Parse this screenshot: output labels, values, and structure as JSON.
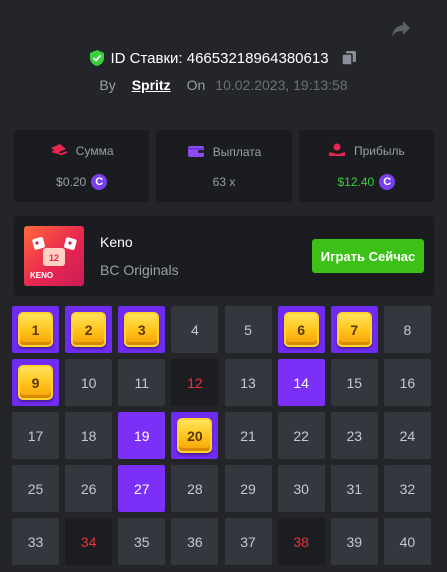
{
  "header": {
    "bet_id": "ID Ставки: 46653218964380613",
    "by_label": "By",
    "username": "Spritz",
    "on_label": "On",
    "datetime": "10.02.2023, 19:13:58"
  },
  "stats": [
    {
      "label": "Сумма",
      "value": "$0.20",
      "icon": "money-icon",
      "coin": true
    },
    {
      "label": "Выплата",
      "value": "63 x",
      "icon": "wallet-icon",
      "coin": false
    },
    {
      "label": "Прибыль",
      "value": "$12.40",
      "icon": "profit-icon",
      "coin": true
    }
  ],
  "coin_symbol": "C",
  "game": {
    "name": "Keno",
    "provider": "BC Originals",
    "play_label": "Играть Сейчас",
    "thumb_label": "KENO",
    "thumb_ball": "12"
  },
  "grid": [
    {
      "n": "1",
      "state": "gem"
    },
    {
      "n": "2",
      "state": "gem"
    },
    {
      "n": "3",
      "state": "gem"
    },
    {
      "n": "4",
      "state": "normal"
    },
    {
      "n": "5",
      "state": "normal"
    },
    {
      "n": "6",
      "state": "gem"
    },
    {
      "n": "7",
      "state": "gem"
    },
    {
      "n": "8",
      "state": "normal"
    },
    {
      "n": "9",
      "state": "gem"
    },
    {
      "n": "10",
      "state": "normal"
    },
    {
      "n": "11",
      "state": "normal"
    },
    {
      "n": "12",
      "state": "miss"
    },
    {
      "n": "13",
      "state": "normal"
    },
    {
      "n": "14",
      "state": "hit"
    },
    {
      "n": "15",
      "state": "normal"
    },
    {
      "n": "16",
      "state": "normal"
    },
    {
      "n": "17",
      "state": "normal"
    },
    {
      "n": "18",
      "state": "normal"
    },
    {
      "n": "19",
      "state": "hit"
    },
    {
      "n": "20",
      "state": "gem-dark"
    },
    {
      "n": "21",
      "state": "normal"
    },
    {
      "n": "22",
      "state": "normal"
    },
    {
      "n": "23",
      "state": "normal"
    },
    {
      "n": "24",
      "state": "normal"
    },
    {
      "n": "25",
      "state": "normal"
    },
    {
      "n": "26",
      "state": "normal"
    },
    {
      "n": "27",
      "state": "hit"
    },
    {
      "n": "28",
      "state": "normal"
    },
    {
      "n": "29",
      "state": "normal"
    },
    {
      "n": "30",
      "state": "normal"
    },
    {
      "n": "31",
      "state": "normal"
    },
    {
      "n": "32",
      "state": "normal"
    },
    {
      "n": "33",
      "state": "normal"
    },
    {
      "n": "34",
      "state": "miss"
    },
    {
      "n": "35",
      "state": "normal"
    },
    {
      "n": "36",
      "state": "normal"
    },
    {
      "n": "37",
      "state": "normal"
    },
    {
      "n": "38",
      "state": "miss"
    },
    {
      "n": "39",
      "state": "normal"
    },
    {
      "n": "40",
      "state": "normal"
    }
  ],
  "colors": {
    "background": "#232529",
    "panel": "#1a1c1f",
    "accent_purple": "#7b2ff7",
    "play_green": "#3bc117",
    "profit_green": "#38d13b",
    "miss_red": "#e8353d",
    "gem_yellow": "#ffc31a"
  }
}
